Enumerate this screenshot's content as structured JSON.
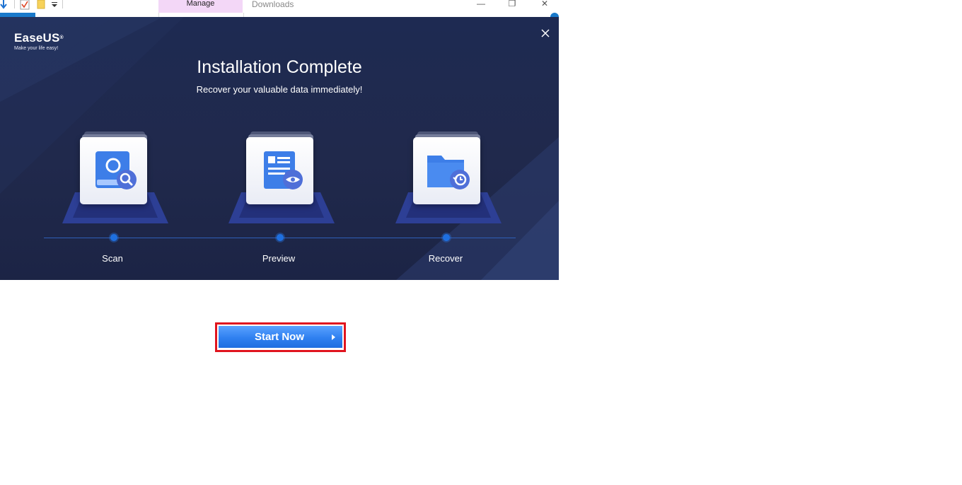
{
  "explorer": {
    "tab_manage": "Manage",
    "tab_downloads": "Downloads"
  },
  "dialog": {
    "logo_name": "EaseUS",
    "logo_reg": "®",
    "logo_tagline": "Make your life easy!",
    "title": "Installation Complete",
    "subtitle": "Recover your valuable data immediately!",
    "steps": [
      {
        "label": "Scan",
        "icon": "scan-magnifier-icon"
      },
      {
        "label": "Preview",
        "icon": "document-eye-icon"
      },
      {
        "label": "Recover",
        "icon": "folder-restore-icon"
      }
    ],
    "start_button": "Start Now"
  },
  "colors": {
    "dialog_bg": "#1e2a52",
    "accent_blue": "#2f80f0",
    "highlight_red": "#e0141e"
  }
}
